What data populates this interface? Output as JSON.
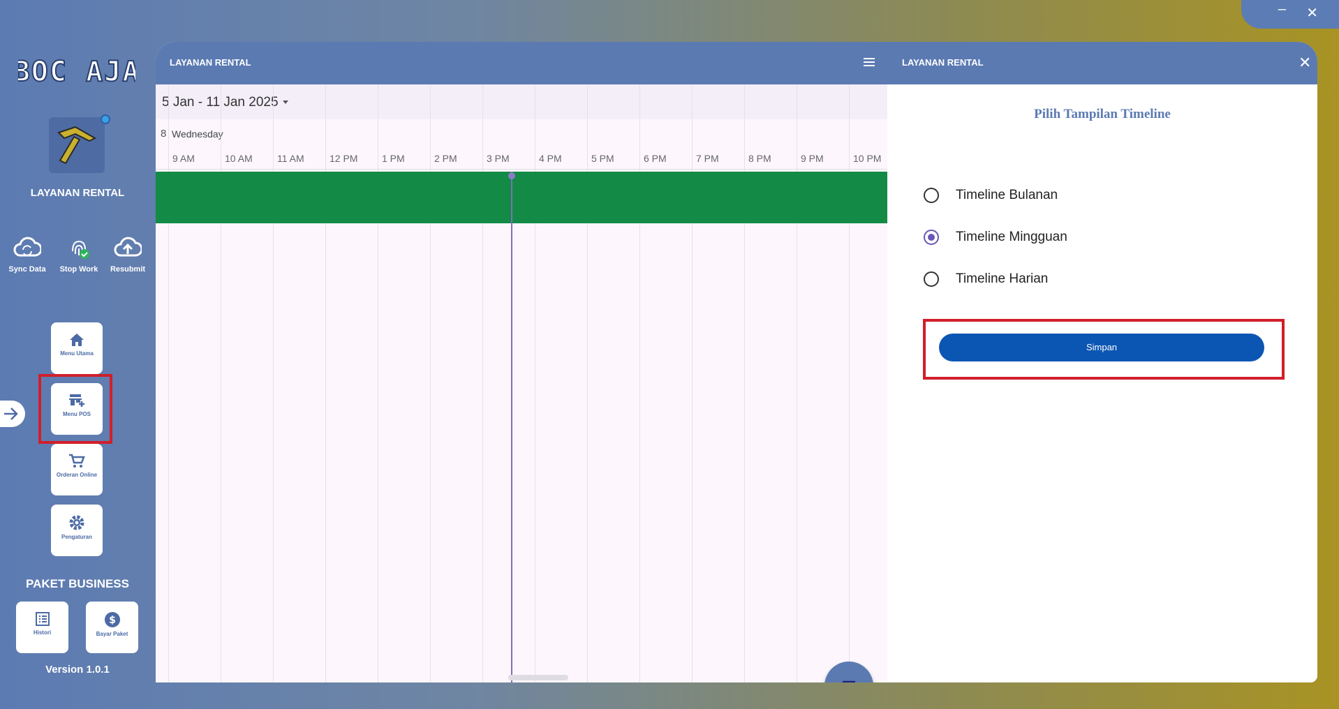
{
  "window": {
    "minimize_label": "–",
    "close_label": "✕"
  },
  "sidebar": {
    "logo_text": "BOC AJA",
    "app_title": "LAYANAN RENTAL",
    "quick_actions": [
      {
        "label": "Sync Data",
        "icon": "cloud-sync-icon"
      },
      {
        "label": "Stop Work",
        "icon": "fingerprint-check-icon"
      },
      {
        "label": "Resubmit",
        "icon": "cloud-upload-icon"
      }
    ],
    "menu": [
      {
        "label": "Menu Utama",
        "icon": "home-icon"
      },
      {
        "label": "Menu POS",
        "icon": "store-add-icon"
      },
      {
        "label": "Orderan Online",
        "icon": "cart-icon"
      },
      {
        "label": "Pengaturan",
        "icon": "gear-icon"
      }
    ],
    "paket_title": "PAKET BUSINESS",
    "paket_buttons": [
      {
        "label": "Histori",
        "icon": "list-icon"
      },
      {
        "label": "Bayar Paket",
        "icon": "dollar-icon"
      }
    ],
    "version": "Version 1.0.1"
  },
  "main": {
    "header_title_left": "LAYANAN RENTAL",
    "header_title_right": "LAYANAN RENTAL",
    "date_range": "5 Jan - 11 Jan 2025",
    "day_number": "8",
    "day_name": "Wednesday",
    "hours": [
      "9 AM",
      "10 AM",
      "11 AM",
      "12 PM",
      "1 PM",
      "2 PM",
      "3 PM",
      "4 PM",
      "5 PM",
      "6 PM",
      "7 PM",
      "8 PM",
      "9 PM",
      "10 PM"
    ],
    "event_color": "#138a46"
  },
  "panel": {
    "title": "Pilih Tampilan Timeline",
    "options": [
      {
        "label": "Timeline Bulanan",
        "checked": false
      },
      {
        "label": "Timeline Mingguan",
        "checked": true
      },
      {
        "label": "Timeline Harian",
        "checked": false
      }
    ],
    "save_label": "Simpan"
  }
}
